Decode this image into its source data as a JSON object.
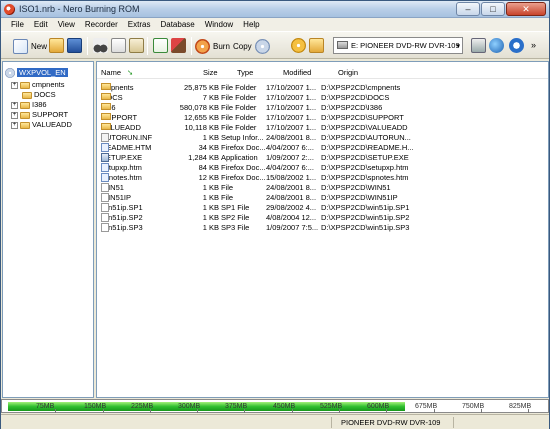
{
  "window": {
    "title": "ISO1.nrb - Nero Burning ROM"
  },
  "title_buttons": {
    "minimize": "–",
    "maximize": "□",
    "close": "✕"
  },
  "menu": [
    "File",
    "Edit",
    "View",
    "Recorder",
    "Extras",
    "Database",
    "Window",
    "Help"
  ],
  "toolbar": {
    "new_label": "New",
    "burn_label": "Burn",
    "copy_label": "Copy",
    "drive": "E: PIONEER DVD-RW  DVR-109",
    "drive_arrow": "▾",
    "more": "»"
  },
  "tree": {
    "root": "WXPVOL_EN",
    "expand": "+",
    "items": [
      "cmpnents",
      "DOCS",
      "I386",
      "SUPPORT",
      "VALUEADD"
    ]
  },
  "list": {
    "columns": {
      "name": "Name",
      "size": "Size",
      "type": "Type",
      "modified": "Modified",
      "origin": "Origin"
    },
    "rows": [
      {
        "name": "cmpnents",
        "size": "25,875 KB",
        "type": "File Folder",
        "modified": "17/10/2007 1...",
        "origin": "D:\\XPSP2CD\\cmpnents",
        "icon": "folder"
      },
      {
        "name": "DOCS",
        "size": "7 KB",
        "type": "File Folder",
        "modified": "17/10/2007 1...",
        "origin": "D:\\XPSP2CD\\DOCS",
        "icon": "folder"
      },
      {
        "name": "I386",
        "size": "580,078 KB",
        "type": "File Folder",
        "modified": "17/10/2007 1...",
        "origin": "D:\\XPSP2CD\\I386",
        "icon": "folder"
      },
      {
        "name": "SUPPORT",
        "size": "12,655 KB",
        "type": "File Folder",
        "modified": "17/10/2007 1...",
        "origin": "D:\\XPSP2CD\\SUPPORT",
        "icon": "folder"
      },
      {
        "name": "VALUEADD",
        "size": "10,118 KB",
        "type": "File Folder",
        "modified": "17/10/2007 1...",
        "origin": "D:\\XPSP2CD\\VALUEADD",
        "icon": "folder"
      },
      {
        "name": "AUTORUN.INF",
        "size": "1 KB",
        "type": "Setup Infor...",
        "modified": "24/08/2001 8...",
        "origin": "D:\\XPSP2CD\\AUTORUN...",
        "icon": "inf"
      },
      {
        "name": "README.HTM",
        "size": "34 KB",
        "type": "Firefox Doc...",
        "modified": "4/04/2007 6:...",
        "origin": "D:\\XPSP2CD\\README.H...",
        "icon": "htm"
      },
      {
        "name": "SETUP.EXE",
        "size": "1,284 KB",
        "type": "Application",
        "modified": "1/09/2007 2:...",
        "origin": "D:\\XPSP2CD\\SETUP.EXE",
        "icon": "app"
      },
      {
        "name": "setupxp.htm",
        "size": "84 KB",
        "type": "Firefox Doc...",
        "modified": "4/04/2007 6:...",
        "origin": "D:\\XPSP2CD\\setupxp.htm",
        "icon": "htm"
      },
      {
        "name": "spnotes.htm",
        "size": "12 KB",
        "type": "Firefox Doc...",
        "modified": "15/08/2002 1...",
        "origin": "D:\\XPSP2CD\\spnotes.htm",
        "icon": "htm"
      },
      {
        "name": "WIN51",
        "size": "1 KB",
        "type": "File",
        "modified": "24/08/2001 8...",
        "origin": "D:\\XPSP2CD\\WIN51",
        "icon": "file"
      },
      {
        "name": "WIN51IP",
        "size": "1 KB",
        "type": "File",
        "modified": "24/08/2001 8...",
        "origin": "D:\\XPSP2CD\\WIN51IP",
        "icon": "file"
      },
      {
        "name": "win51ip.SP1",
        "size": "1 KB",
        "type": "SP1 File",
        "modified": "29/08/2002 4...",
        "origin": "D:\\XPSP2CD\\win51ip.SP1",
        "icon": "file"
      },
      {
        "name": "win51ip.SP2",
        "size": "1 KB",
        "type": "SP2 File",
        "modified": "4/08/2004 12...",
        "origin": "D:\\XPSP2CD\\win51ip.SP2",
        "icon": "file"
      },
      {
        "name": "win51ip.SP3",
        "size": "1 KB",
        "type": "SP3 File",
        "modified": "1/09/2007 7:5...",
        "origin": "D:\\XPSP2CD\\win51ip.SP3",
        "icon": "file"
      }
    ]
  },
  "capacity": {
    "marks": [
      "75MB",
      "150MB",
      "225MB",
      "300MB",
      "375MB",
      "450MB",
      "525MB",
      "600MB",
      "675MB",
      "750MB",
      "825MB"
    ],
    "max_mb": 850,
    "used_mb": 630
  },
  "status": {
    "drive": "PIONEER  DVD-RW  DVR-109"
  },
  "colors": {
    "capacity_fill": "#2fbf2f",
    "selection": "#316ac5"
  }
}
